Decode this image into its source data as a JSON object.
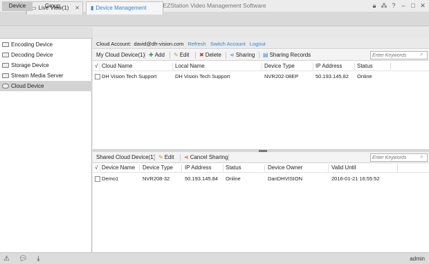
{
  "window": {
    "menu_label": "menu",
    "title": "EZStation Video Management Software"
  },
  "tabs": {
    "live_view": "Live View(1)",
    "device_management": "Device Management"
  },
  "subtabs": [
    "Device",
    "Group"
  ],
  "tree": [
    "Encoding Device",
    "Decoding Device",
    "Storage Device",
    "Stream Media Server",
    "Cloud Device"
  ],
  "account": {
    "label": "Cloud Account:",
    "email": "david@dh-vision.com",
    "refresh": "Refresh",
    "switch": "Switch Account",
    "logout": "Logout"
  },
  "my_cloud": {
    "title": "My Cloud Device(1)",
    "add": "Add",
    "edit": "Edit",
    "delete": "Delete",
    "sharing": "Sharing",
    "sharing_records": "Sharing Records",
    "search_placeholder": "Enter Keywords",
    "columns": [
      "√",
      "Cloud Name",
      "Local Name",
      "Device Type",
      "IP Address",
      "Status"
    ],
    "rows": [
      {
        "cloud_name": "DH Vision Tech Support",
        "local_name": "DH Vision Tech Support",
        "device_type": "NVR202-08EP",
        "ip": "50.193.145.82",
        "status": "Online"
      }
    ]
  },
  "shared_cloud": {
    "title": "Shared Cloud Device(1)",
    "edit": "Edit",
    "cancel_sharing": "Cancel Sharing",
    "search_placeholder": "Enter Keywords",
    "columns": [
      "√",
      "Device Name",
      "Device Type",
      "IP Address",
      "Status",
      "Device Owner",
      "Valid Until"
    ],
    "rows": [
      {
        "device_name": "Demo1",
        "device_type": "NVR208-32",
        "ip": "50.193.145.84",
        "status": "Online",
        "owner": "DanDHVISION",
        "valid_until": "2016-01-21 16:55:52"
      }
    ]
  },
  "status_bar": {
    "user": "admin"
  },
  "colors": {
    "accent": "#2f86d6",
    "delete": "#c0392b",
    "add": "#2e9e3e",
    "edit": "#d98a1a"
  }
}
